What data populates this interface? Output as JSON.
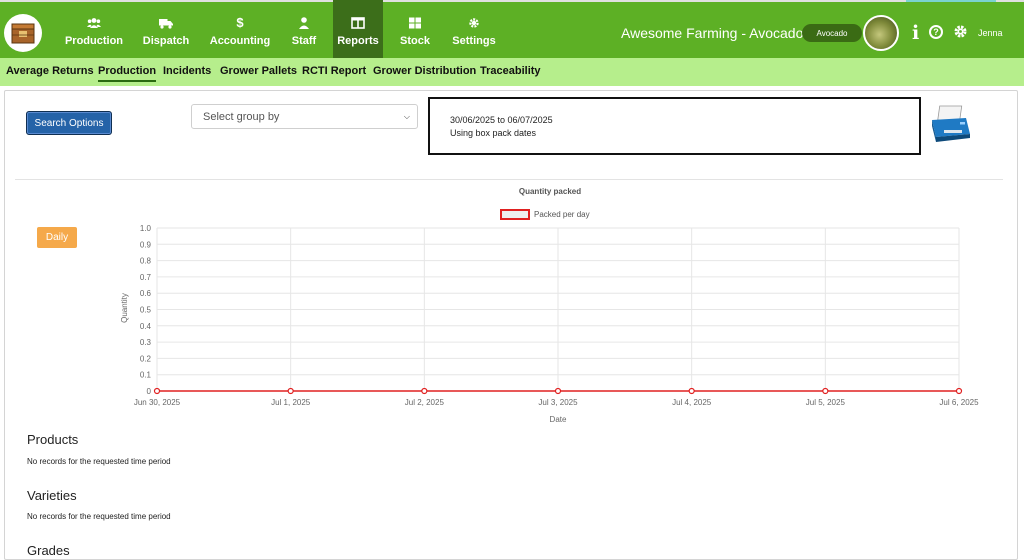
{
  "app": {
    "title": "Awesome Farming - Avocados",
    "variety": "Avocado",
    "username": "Jenna",
    "colors": {
      "nav_green": "#5db025",
      "nav_active": "#3c6e1a",
      "subnav_green": "#b6ee8c",
      "accent_blue": "#2563a8",
      "daily_orange": "#f5a94a",
      "series_red": "#e02020"
    }
  },
  "nav": {
    "items": [
      {
        "label": "Production",
        "icon": "users-icon"
      },
      {
        "label": "Dispatch",
        "icon": "truck-icon"
      },
      {
        "label": "Accounting",
        "icon": "dollar-icon"
      },
      {
        "label": "Staff",
        "icon": "user-icon"
      },
      {
        "label": "Reports",
        "icon": "columns-icon",
        "active": true
      },
      {
        "label": "Stock",
        "icon": "grid-icon"
      },
      {
        "label": "Settings",
        "icon": "cog-icon"
      }
    ]
  },
  "subnav": {
    "items": [
      "Average Returns",
      "Production",
      "Incidents",
      "Grower Pallets",
      "RCTI Report",
      "Grower Distribution",
      "Traceability"
    ],
    "active": "Production"
  },
  "controls": {
    "search_label": "Search Options",
    "group_placeholder": "Select group by",
    "date_range": "30/06/2025 to 06/07/2025",
    "date_mode": "Using box pack dates",
    "daily_label": "Daily"
  },
  "chart_data": {
    "type": "line",
    "title": "Quantity packed",
    "xlabel": "Date",
    "ylabel": "Quantity",
    "categories": [
      "Jun 30, 2025",
      "Jul 1, 2025",
      "Jul 2, 2025",
      "Jul 3, 2025",
      "Jul 4, 2025",
      "Jul 5, 2025",
      "Jul 6, 2025"
    ],
    "series": [
      {
        "name": "Packed per day",
        "values": [
          0,
          0,
          0,
          0,
          0,
          0,
          0
        ],
        "color": "#e02020"
      }
    ],
    "ylim": [
      0,
      1.0
    ],
    "yticks": [
      "0",
      "0.1",
      "0.2",
      "0.3",
      "0.4",
      "0.5",
      "0.6",
      "0.7",
      "0.8",
      "0.9",
      "1.0"
    ],
    "grid": true,
    "legend": "top"
  },
  "sections": {
    "products": {
      "title": "Products",
      "note": "No records for the requested time period"
    },
    "varieties": {
      "title": "Varieties",
      "note": "No records for the requested time period"
    },
    "grades": {
      "title": "Grades"
    }
  }
}
